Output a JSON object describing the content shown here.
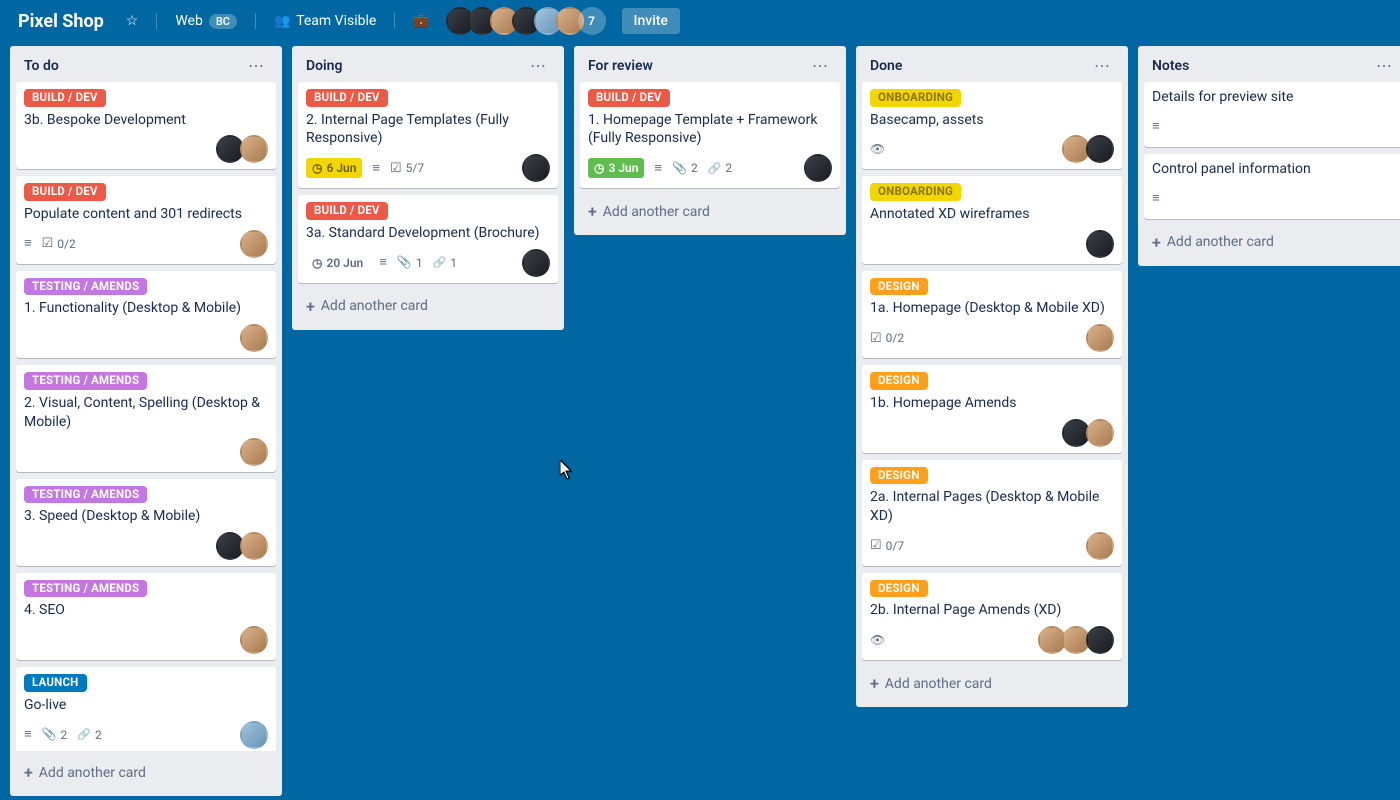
{
  "header": {
    "board_title": "Pixel Shop",
    "web_label": "Web",
    "web_pill": "BC",
    "visibility_label": "Team Visible",
    "avatar_overflow_count": "7",
    "invite_label": "Invite"
  },
  "add_card_label": "Add another card",
  "labels": {
    "build_dev": "BUILD / DEV",
    "testing_amends": "TESTING / AMENDS",
    "launch": "LAUNCH",
    "onboarding": "ONBOARDING",
    "design": "DESIGN"
  },
  "lists": [
    {
      "title": "To do",
      "cards": [
        {
          "label_key": "build_dev",
          "label_color": "red",
          "title": "3b. Bespoke Development",
          "members": [
            "dark",
            "warm"
          ]
        },
        {
          "label_key": "build_dev",
          "label_color": "red",
          "title": "Populate content and 301 redirects",
          "desc": true,
          "checklist": "0/2",
          "members": [
            "warm"
          ]
        },
        {
          "label_key": "testing_amends",
          "label_color": "pink",
          "title": "1. Functionality (Desktop & Mobile)",
          "members": [
            "warm"
          ]
        },
        {
          "label_key": "testing_amends",
          "label_color": "pink",
          "title": "2. Visual, Content, Spelling (Desktop & Mobile)",
          "members": [
            "warm"
          ]
        },
        {
          "label_key": "testing_amends",
          "label_color": "pink",
          "title": "3. Speed (Desktop & Mobile)",
          "members": [
            "dark",
            "warm"
          ]
        },
        {
          "label_key": "testing_amends",
          "label_color": "pink",
          "title": "4. SEO",
          "members": [
            "warm"
          ]
        },
        {
          "label_key": "launch",
          "label_color": "blue",
          "title": "Go-live",
          "desc": true,
          "attachments": "2",
          "links": "2",
          "members": [
            "cool"
          ]
        }
      ]
    },
    {
      "title": "Doing",
      "cards": [
        {
          "label_key": "build_dev",
          "label_color": "red",
          "title": "2. Internal Page Templates (Fully Responsive)",
          "due": "6 Jun",
          "due_style": "yellow",
          "desc": true,
          "checklist": "5/7",
          "members": [
            "dark"
          ]
        },
        {
          "label_key": "build_dev",
          "label_color": "red",
          "title": "3a. Standard Development (Brochure)",
          "due": "20 Jun",
          "due_style": "plain",
          "desc": true,
          "attachments": "1",
          "links": "1",
          "members": [
            "dark"
          ]
        }
      ]
    },
    {
      "title": "For review",
      "cards": [
        {
          "label_key": "build_dev",
          "label_color": "red",
          "title": "1. Homepage Template + Framework (Fully Responsive)",
          "due": "3 Jun",
          "due_style": "green",
          "desc": true,
          "attachments": "2",
          "links": "2",
          "members": [
            "dark"
          ]
        }
      ]
    },
    {
      "title": "Done",
      "cards": [
        {
          "label_key": "onboarding",
          "label_color": "yellow",
          "title": "Basecamp, assets",
          "watching": true,
          "members": [
            "warm",
            "dark"
          ]
        },
        {
          "label_key": "onboarding",
          "label_color": "yellow",
          "title": "Annotated XD wireframes",
          "members": [
            "dark"
          ]
        },
        {
          "label_key": "design",
          "label_color": "orange",
          "title": "1a. Homepage (Desktop & Mobile XD)",
          "checklist": "0/2",
          "members": [
            "warm"
          ]
        },
        {
          "label_key": "design",
          "label_color": "orange",
          "title": "1b. Homepage Amends",
          "members": [
            "dark",
            "warm"
          ]
        },
        {
          "label_key": "design",
          "label_color": "orange",
          "title": "2a. Internal Pages (Desktop & Mobile XD)",
          "checklist": "0/7",
          "members": [
            "warm"
          ]
        },
        {
          "label_key": "design",
          "label_color": "orange",
          "title": "2b. Internal Page Amends (XD)",
          "watching": true,
          "members": [
            "warm",
            "warm",
            "dark"
          ]
        }
      ]
    },
    {
      "title": "Notes",
      "cards": [
        {
          "title": "Details for preview site",
          "desc": true
        },
        {
          "title": "Control panel information",
          "desc": true
        }
      ]
    }
  ]
}
